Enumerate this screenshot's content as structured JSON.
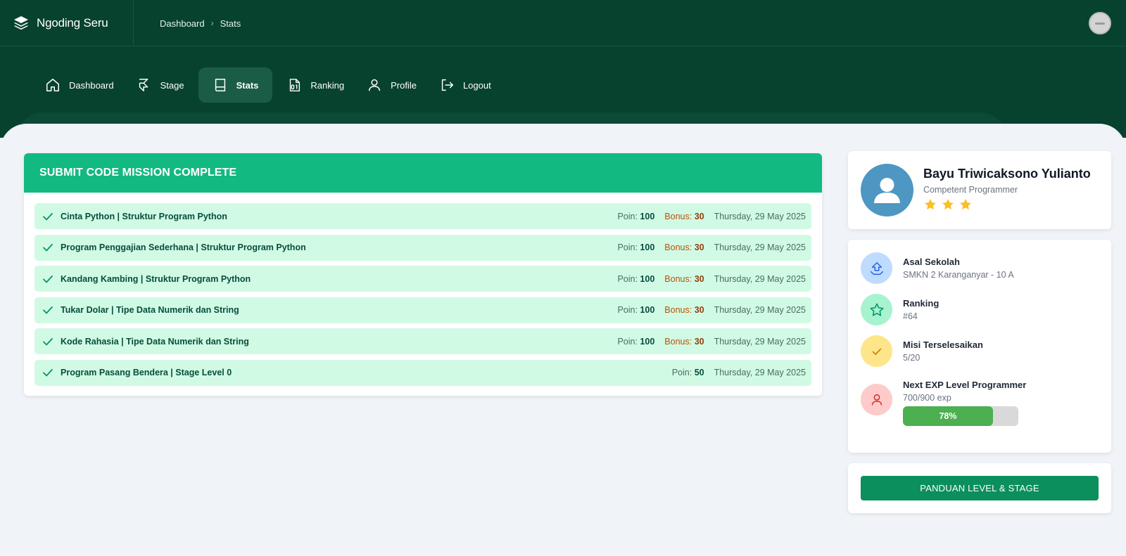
{
  "app": {
    "name": "Ngoding Seru"
  },
  "breadcrumb": {
    "items": [
      "Dashboard",
      "Stats"
    ]
  },
  "nav": {
    "items": [
      {
        "label": "Dashboard",
        "icon": "home-icon"
      },
      {
        "label": "Stage",
        "icon": "stage-icon"
      },
      {
        "label": "Stats",
        "icon": "book-icon",
        "active": true
      },
      {
        "label": "Ranking",
        "icon": "ranking-icon"
      },
      {
        "label": "Profile",
        "icon": "user-icon"
      },
      {
        "label": "Logout",
        "icon": "logout-icon"
      }
    ]
  },
  "missions": {
    "header": "SUBMIT CODE MISSION COMPLETE",
    "poin_label": "Poin:",
    "bonus_label": "Bonus:",
    "rows": [
      {
        "title": "Cinta Python | Struktur Program Python",
        "poin": "100",
        "bonus": "30",
        "date": "Thursday, 29 May 2025"
      },
      {
        "title": "Program Penggajian Sederhana | Struktur Program Python",
        "poin": "100",
        "bonus": "30",
        "date": "Thursday, 29 May 2025"
      },
      {
        "title": "Kandang Kambing | Struktur Program Python",
        "poin": "100",
        "bonus": "30",
        "date": "Thursday, 29 May 2025"
      },
      {
        "title": "Tukar Dolar | Tipe Data Numerik dan String",
        "poin": "100",
        "bonus": "30",
        "date": "Thursday, 29 May 2025"
      },
      {
        "title": "Kode Rahasia | Tipe Data Numerik dan String",
        "poin": "100",
        "bonus": "30",
        "date": "Thursday, 29 May 2025"
      },
      {
        "title": "Program Pasang Bendera | Stage Level 0",
        "poin": "50",
        "bonus": null,
        "date": "Thursday, 29 May 2025"
      }
    ]
  },
  "profile": {
    "name": "Bayu Triwicaksono Yulianto",
    "role": "Competent Programmer",
    "stars": 3
  },
  "info": {
    "school": {
      "label": "Asal Sekolah",
      "value": "SMKN 2 Karanganyar - 10 A"
    },
    "ranking": {
      "label": "Ranking",
      "value": "#64"
    },
    "missions_done": {
      "label": "Misi Terselesaikan",
      "value": "5/20"
    },
    "next_level": {
      "label": "Next EXP Level Programmer",
      "value": "700/900 exp",
      "progress_label": "78%",
      "progress": 0.78
    }
  },
  "guide": {
    "button_label": "PANDUAN LEVEL & STAGE"
  },
  "colors": {
    "header_bg": "#07422f",
    "accent_green": "#12b981",
    "row_bg": "#d1fae5",
    "bonus": "#b45309",
    "star": "#fbbf24",
    "button": "#0b8f5c"
  }
}
